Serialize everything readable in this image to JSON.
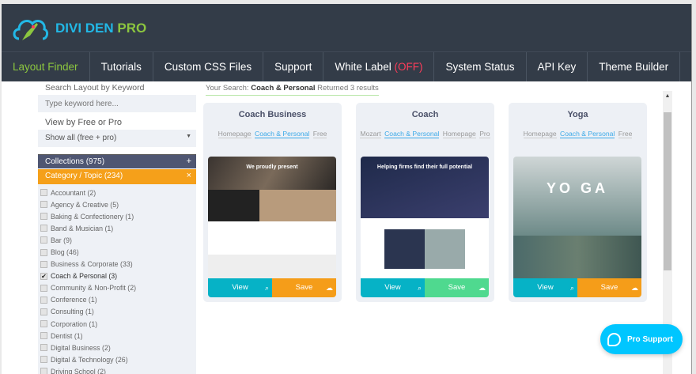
{
  "brand": {
    "name_a": "DIVI DEN",
    "name_b": "PRO"
  },
  "nav": [
    {
      "label": "Layout Finder"
    },
    {
      "label": "Tutorials"
    },
    {
      "label": "Custom CSS Files"
    },
    {
      "label": "Support"
    },
    {
      "label": "White Label",
      "badge": "(OFF)"
    },
    {
      "label": "System Status"
    },
    {
      "label": "API Key"
    },
    {
      "label": "Theme Builder"
    }
  ],
  "sidebar": {
    "search_label": "Search Layout by Keyword",
    "keyword_placeholder": "Type keyword here...",
    "view_label": "View by Free or Pro",
    "view_value": "Show all (free + pro)",
    "collections": "Collections (975)",
    "category": "Category / Topic (234)",
    "categories": [
      {
        "label": "Accountant (2)",
        "checked": false
      },
      {
        "label": "Agency & Creative (5)",
        "checked": false
      },
      {
        "label": "Baking & Confectionery (1)",
        "checked": false
      },
      {
        "label": "Band & Musician (1)",
        "checked": false
      },
      {
        "label": "Bar (9)",
        "checked": false
      },
      {
        "label": "Blog (46)",
        "checked": false
      },
      {
        "label": "Business & Corporate (33)",
        "checked": false
      },
      {
        "label": "Coach & Personal (3)",
        "checked": true
      },
      {
        "label": "Community & Non-Profit (2)",
        "checked": false
      },
      {
        "label": "Conference (1)",
        "checked": false
      },
      {
        "label": "Consulting (1)",
        "checked": false
      },
      {
        "label": "Corporation (1)",
        "checked": false
      },
      {
        "label": "Dentist (1)",
        "checked": false
      },
      {
        "label": "Digital Business (2)",
        "checked": false
      },
      {
        "label": "Digital & Technology (26)",
        "checked": false
      },
      {
        "label": "Driving School (2)",
        "checked": false
      }
    ]
  },
  "search": {
    "prefix": "Your Search:",
    "term": "Coach & Personal",
    "result": "Returned 3 results"
  },
  "cards": [
    {
      "title": "Coach Business",
      "tags": [
        "Homepage",
        "Coach & Personal",
        "Free"
      ],
      "hl": 1,
      "thumb_text": "We proudly present",
      "view": "View",
      "save": "Save"
    },
    {
      "title": "Coach",
      "tags": [
        "Mozart",
        "Coach & Personal",
        "Homepage",
        "Pro"
      ],
      "hl": 1,
      "thumb_text": "Helping firms find their full potential",
      "view": "View",
      "save": "Save"
    },
    {
      "title": "Yoga",
      "tags": [
        "Homepage",
        "Coach & Personal",
        "Free"
      ],
      "hl": 1,
      "thumb_text": "YO   GA",
      "view": "View",
      "save": "Save"
    }
  ],
  "pro_support": "Pro Support",
  "colors": {
    "header": "#333c48",
    "accent_green": "#8cc63f",
    "view": "#06b2c6",
    "save": "#f59d19"
  }
}
